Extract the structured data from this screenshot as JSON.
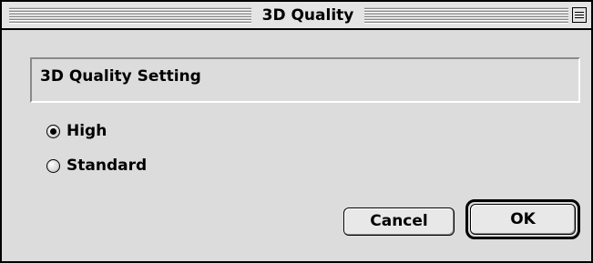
{
  "window": {
    "title": "3D Quality"
  },
  "setting_box": {
    "label": "3D Quality Setting"
  },
  "options": [
    {
      "label": "High",
      "selected": true
    },
    {
      "label": "Standard",
      "selected": false
    }
  ],
  "buttons": {
    "cancel_label": "Cancel",
    "ok_label": "OK"
  },
  "icons": {
    "collapse": "collapse-box-icon",
    "radio_selected": "radio-selected-icon",
    "radio_unselected": "radio-unselected-icon"
  }
}
